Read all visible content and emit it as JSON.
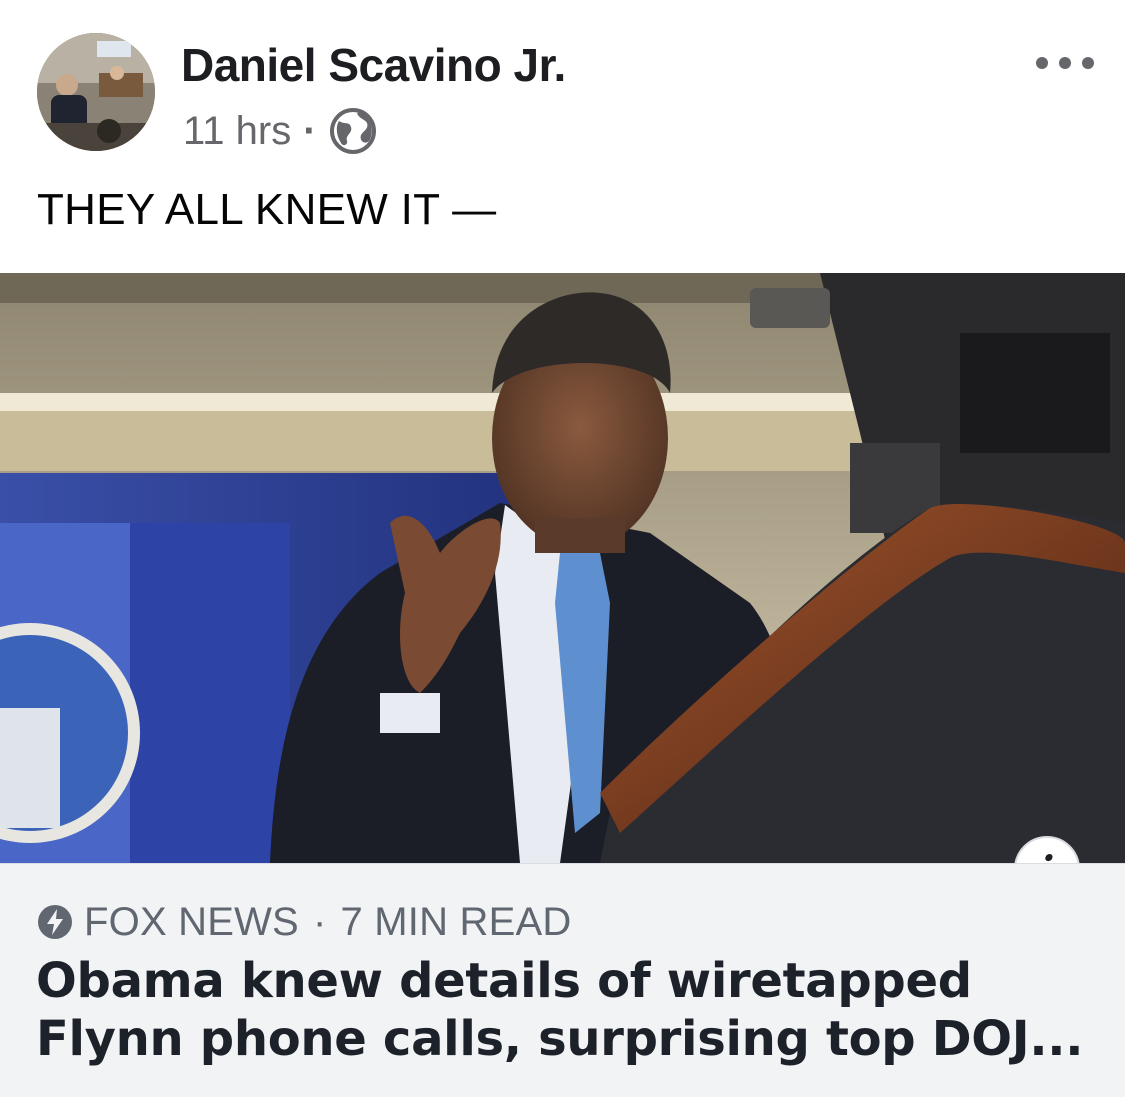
{
  "post": {
    "author": "Daniel Scavino Jr.",
    "time": "11 hrs",
    "meta_separator": "·",
    "audience_icon": "globe-icon",
    "more_icon": "more-dots-icon",
    "text": "THEY ALL KNEW IT —"
  },
  "link_preview": {
    "image_description_icon": "news-photo",
    "info_icon_label": "i",
    "source_icon": "instant-article-bolt-icon",
    "source": "FOX NEWS",
    "separator": "·",
    "read_time": "7 MIN READ",
    "headline_line1": "Obama knew details of wiretapped",
    "headline_line2": "Flynn phone calls, surprising top DOJ..."
  },
  "colors": {
    "text_primary": "#1c1e21",
    "text_secondary": "#65676b",
    "caption_background": "#f2f3f5"
  }
}
